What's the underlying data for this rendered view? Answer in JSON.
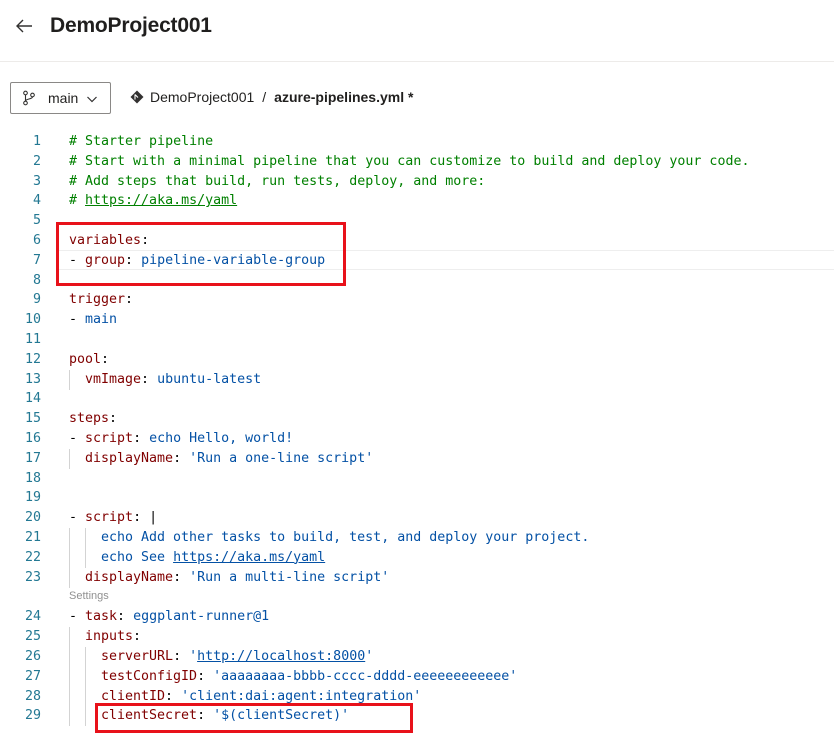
{
  "header": {
    "title": "DemoProject001",
    "back_icon": "arrow-left-icon"
  },
  "toolbar": {
    "branch": "main",
    "branch_icon": "git-branch-icon",
    "repo_icon": "repo-diamond-icon",
    "repo": "DemoProject001",
    "separator": "/",
    "file": "azure-pipelines.yml *"
  },
  "editor": {
    "codelens_label": "Settings",
    "lines": [
      {
        "num": "1",
        "indent": 0,
        "segs": [
          [
            "c",
            "# Starter pipeline"
          ]
        ]
      },
      {
        "num": "2",
        "indent": 0,
        "segs": [
          [
            "c",
            "# Start with a minimal pipeline that you can customize to build and deploy your code."
          ]
        ]
      },
      {
        "num": "3",
        "indent": 0,
        "segs": [
          [
            "c",
            "# Add steps that build, run tests, deploy, and more:"
          ]
        ]
      },
      {
        "num": "4",
        "indent": 0,
        "segs": [
          [
            "c",
            "# "
          ],
          [
            "cl",
            "https://aka.ms/yaml"
          ]
        ]
      },
      {
        "num": "5",
        "indent": 0,
        "segs": []
      },
      {
        "num": "6",
        "indent": 0,
        "segs": [
          [
            "k",
            "variables"
          ],
          [
            "p",
            ":"
          ]
        ]
      },
      {
        "num": "7",
        "indent": 0,
        "segs": [
          [
            "p",
            "- "
          ],
          [
            "k",
            "group"
          ],
          [
            "p",
            ": "
          ],
          [
            "s",
            "pipeline-variable-group"
          ]
        ]
      },
      {
        "num": "8",
        "indent": 0,
        "segs": []
      },
      {
        "num": "9",
        "indent": 0,
        "segs": [
          [
            "k",
            "trigger"
          ],
          [
            "p",
            ":"
          ]
        ]
      },
      {
        "num": "10",
        "indent": 0,
        "segs": [
          [
            "p",
            "- "
          ],
          [
            "s",
            "main"
          ]
        ]
      },
      {
        "num": "11",
        "indent": 0,
        "segs": []
      },
      {
        "num": "12",
        "indent": 0,
        "segs": [
          [
            "k",
            "pool"
          ],
          [
            "p",
            ":"
          ]
        ]
      },
      {
        "num": "13",
        "indent": 1,
        "segs": [
          [
            "k",
            "vmImage"
          ],
          [
            "p",
            ": "
          ],
          [
            "s",
            "ubuntu-latest"
          ]
        ]
      },
      {
        "num": "14",
        "indent": 0,
        "segs": []
      },
      {
        "num": "15",
        "indent": 0,
        "segs": [
          [
            "k",
            "steps"
          ],
          [
            "p",
            ":"
          ]
        ]
      },
      {
        "num": "16",
        "indent": 0,
        "segs": [
          [
            "p",
            "- "
          ],
          [
            "k",
            "script"
          ],
          [
            "p",
            ": "
          ],
          [
            "s",
            "echo Hello, world!"
          ]
        ]
      },
      {
        "num": "17",
        "indent": 1,
        "segs": [
          [
            "k",
            "displayName"
          ],
          [
            "p",
            ": "
          ],
          [
            "s",
            "'Run a one-line script'"
          ]
        ]
      },
      {
        "num": "18",
        "indent": 0,
        "segs": []
      },
      {
        "num": "19",
        "indent": 0,
        "segs": []
      },
      {
        "num": "20",
        "indent": 0,
        "segs": [
          [
            "p",
            "- "
          ],
          [
            "k",
            "script"
          ],
          [
            "p",
            ": "
          ],
          [
            "p",
            "|"
          ]
        ]
      },
      {
        "num": "21",
        "indent": 2,
        "segs": [
          [
            "s",
            "echo Add other tasks to build, test, and deploy your project."
          ]
        ]
      },
      {
        "num": "22",
        "indent": 2,
        "segs": [
          [
            "s",
            "echo See "
          ],
          [
            "sl",
            "https://aka.ms/yaml"
          ]
        ]
      },
      {
        "num": "23",
        "indent": 1,
        "segs": [
          [
            "k",
            "displayName"
          ],
          [
            "p",
            ": "
          ],
          [
            "s",
            "'Run a multi-line script'"
          ]
        ]
      },
      {
        "num": "24",
        "indent": 0,
        "segs": [
          [
            "p",
            "- "
          ],
          [
            "k",
            "task"
          ],
          [
            "p",
            ": "
          ],
          [
            "s",
            "eggplant-runner@1"
          ]
        ]
      },
      {
        "num": "25",
        "indent": 1,
        "segs": [
          [
            "k",
            "inputs"
          ],
          [
            "p",
            ":"
          ]
        ]
      },
      {
        "num": "26",
        "indent": 2,
        "segs": [
          [
            "k",
            "serverURL"
          ],
          [
            "p",
            ": "
          ],
          [
            "s",
            "'"
          ],
          [
            "sl",
            "http://localhost:8000"
          ],
          [
            "s",
            "'"
          ]
        ]
      },
      {
        "num": "27",
        "indent": 2,
        "segs": [
          [
            "k",
            "testConfigID"
          ],
          [
            "p",
            ": "
          ],
          [
            "s",
            "'aaaaaaaa-bbbb-cccc-dddd-eeeeeeeeeeee'"
          ]
        ]
      },
      {
        "num": "28",
        "indent": 2,
        "segs": [
          [
            "k",
            "clientID"
          ],
          [
            "p",
            ": "
          ],
          [
            "s",
            "'client:dai:agent:integration'"
          ]
        ]
      },
      {
        "num": "29",
        "indent": 2,
        "segs": [
          [
            "k",
            "clientSecret"
          ],
          [
            "p",
            ": "
          ],
          [
            "s",
            "'$(clientSecret)'"
          ]
        ]
      }
    ]
  },
  "colors": {
    "comment": "#008000",
    "key": "#800000",
    "string": "#0451a5",
    "line_number": "#237893",
    "highlight_box": "#e8111a"
  }
}
